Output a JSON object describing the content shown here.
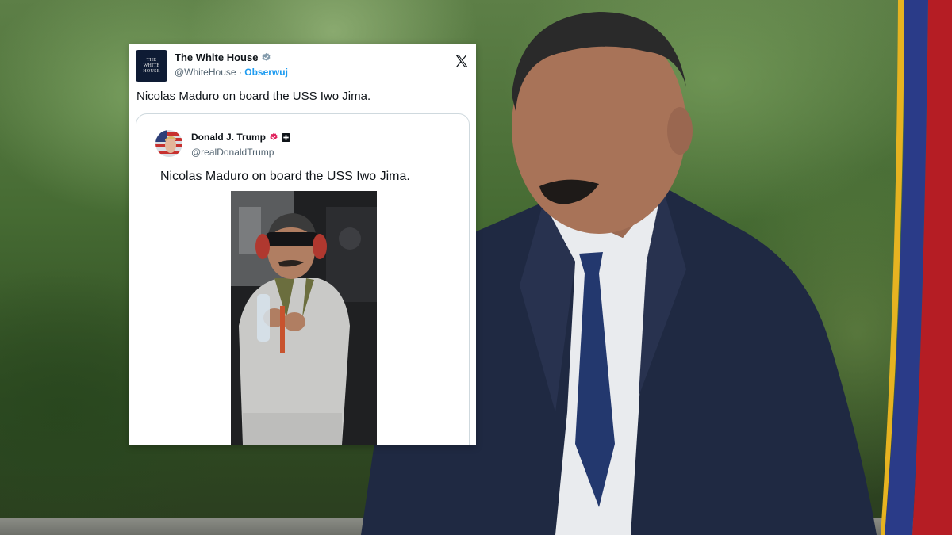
{
  "colors": {
    "follow_blue": "#1d9bf0",
    "text_primary": "#0f1419",
    "text_secondary": "#536471",
    "verified_pink": "#e0245e"
  },
  "main_tweet": {
    "author_name": "The White House",
    "avatar_text": [
      "THE",
      "WHITE",
      "HOUSE"
    ],
    "handle": "@WhiteHouse",
    "separator": "·",
    "follow_label": "Obserwuj",
    "text": "Nicolas Maduro on board the USS Iwo Jima.",
    "icons": {
      "verified": "verified-badge-grey-icon",
      "platform": "x-logo-icon"
    }
  },
  "quoted_tweet": {
    "author_name": "Donald J. Trump",
    "handle": "@realDonaldTrump",
    "text": "Nicolas Maduro on board the USS Iwo Jima.",
    "icons": {
      "verified": "verified-badge-icon",
      "affiliate": "plus-badge-icon"
    }
  }
}
